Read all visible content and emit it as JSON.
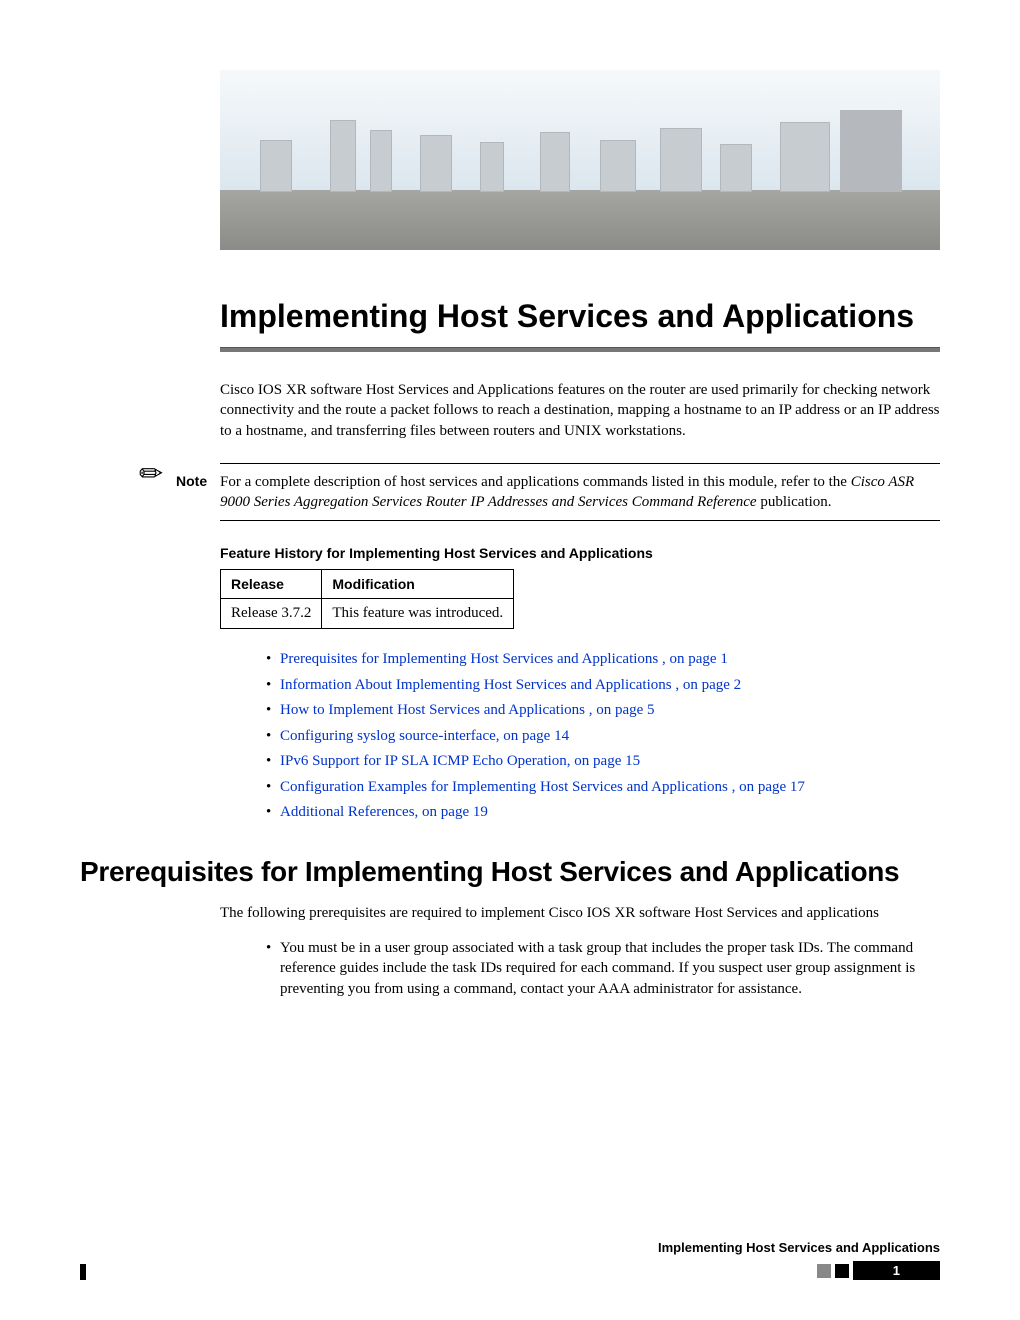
{
  "title": "Implementing Host Services and Applications",
  "intro": "Cisco IOS XR software Host Services and Applications features on the router are used primarily for checking network connectivity and the route a packet follows to reach a destination, mapping a hostname to an IP address or an IP address to a hostname, and transferring files between routers and UNIX workstations.",
  "note": {
    "label": "Note",
    "text_before": "For a complete description of host services and applications commands listed in this module, refer to the ",
    "italic": "Cisco ASR 9000 Series Aggregation Services Router IP Addresses and Services Command Reference",
    "text_after": " publication."
  },
  "feature_history": {
    "heading": "Feature History for Implementing Host Services and Applications",
    "headers": {
      "col1": "Release",
      "col2": "Modification"
    },
    "row": {
      "release": "Release 3.7.2",
      "modification": "This feature was introduced."
    }
  },
  "toc": [
    "Prerequisites for Implementing Host Services and Applications , on page 1",
    "Information About Implementing Host Services and Applications , on page 2",
    "How to Implement Host Services and Applications , on page 5",
    "Configuring syslog source-interface, on page 14",
    "IPv6 Support for IP SLA ICMP Echo Operation, on page 15",
    "Configuration Examples for Implementing Host Services and Applications , on page 17",
    "Additional References, on page 19"
  ],
  "section": {
    "heading": "Prerequisites for Implementing Host Services and Applications",
    "body": "The following prerequisites are required to implement Cisco IOS XR software Host Services and applications",
    "bullet": "You must be in a user group associated with a task group that includes the proper task IDs. The command reference guides include the task IDs required for each command. If you suspect user group assignment is preventing you from using a command, contact your AAA administrator for assistance."
  },
  "footer": {
    "title": "Implementing Host Services and Applications",
    "page": "1"
  }
}
